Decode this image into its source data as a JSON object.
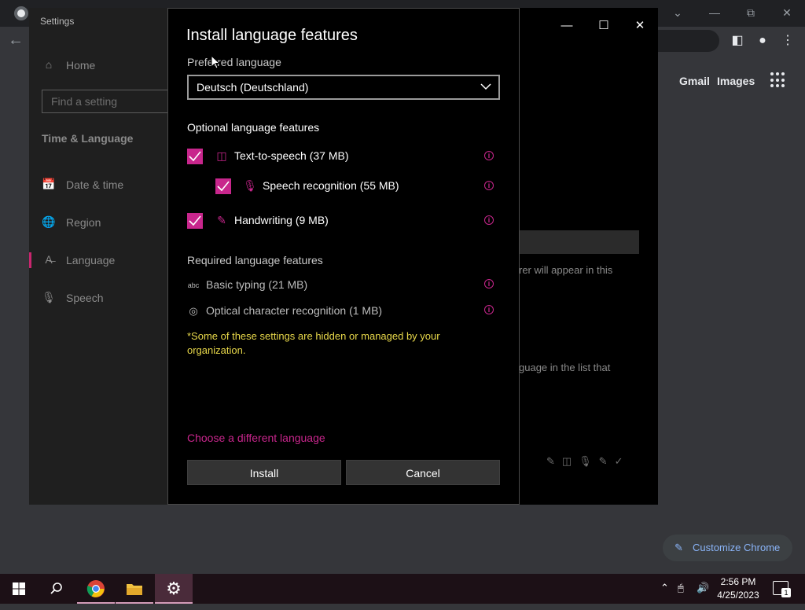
{
  "chrome": {
    "links": [
      "Gmail",
      "Images"
    ],
    "customize_label": "Customize Chrome"
  },
  "settings": {
    "title": "Settings",
    "home": "Home",
    "find_placeholder": "Find a setting",
    "section": "Time & Language",
    "nav": [
      {
        "label": "Date & time",
        "icon": "calendar-clock-icon"
      },
      {
        "label": "Region",
        "icon": "globe-icon"
      },
      {
        "label": "Language",
        "icon": "language-icon"
      },
      {
        "label": "Speech",
        "icon": "microphone-icon"
      }
    ],
    "bg_text_1": "rer will appear in this",
    "bg_text_2": "guage in the list that"
  },
  "dialog": {
    "title": "Install language features",
    "preferred_label": "Preferred language",
    "preferred_value": "Deutsch (Deutschland)",
    "optional_heading": "Optional language features",
    "optional": [
      {
        "label": "Text-to-speech (37 MB)",
        "checked": true,
        "icon": "text-to-speech-icon"
      },
      {
        "label": "Speech recognition (55 MB)",
        "checked": true,
        "icon": "microphone-icon"
      },
      {
        "label": "Handwriting (9 MB)",
        "checked": true,
        "icon": "handwriting-icon"
      }
    ],
    "required_heading": "Required language features",
    "required": [
      {
        "label": "Basic typing (21 MB)",
        "icon": "basic-typing-icon"
      },
      {
        "label": "Optical character recognition (1 MB)",
        "icon": "ocr-icon"
      }
    ],
    "managed_note": "*Some of these settings are hidden or managed by your organization.",
    "choose_link": "Choose a different language",
    "install_label": "Install",
    "cancel_label": "Cancel",
    "accent": "#c8268c"
  },
  "taskbar": {
    "time": "2:56 PM",
    "date": "4/25/2023",
    "notification_count": "1"
  }
}
